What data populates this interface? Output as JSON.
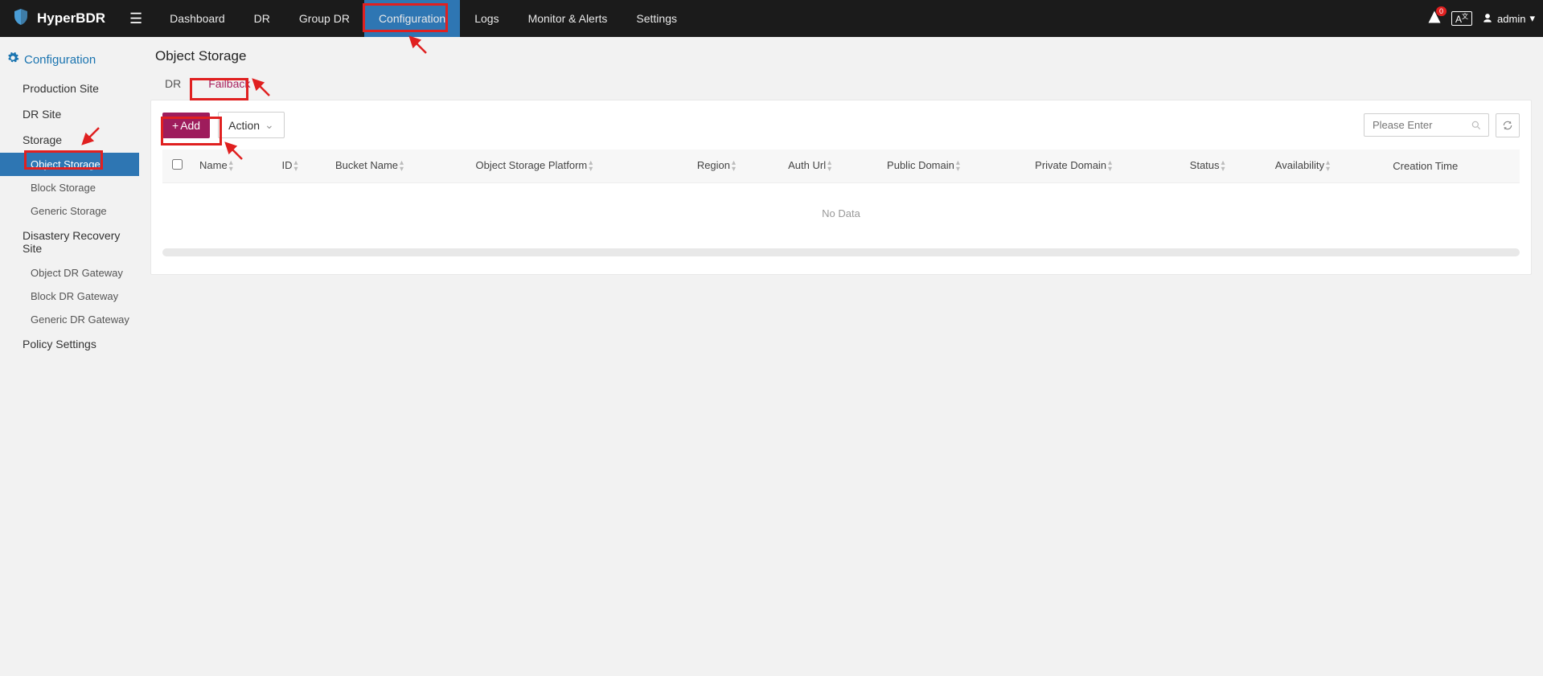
{
  "brand": {
    "name": "HyperBDR"
  },
  "nav": {
    "items": [
      {
        "label": "Dashboard",
        "active": false
      },
      {
        "label": "DR",
        "active": false
      },
      {
        "label": "Group DR",
        "active": false
      },
      {
        "label": "Configuration",
        "active": true
      },
      {
        "label": "Logs",
        "active": false
      },
      {
        "label": "Monitor & Alerts",
        "active": false
      },
      {
        "label": "Settings",
        "active": false
      }
    ]
  },
  "header_right": {
    "notification_count": "0",
    "lang_label": "A",
    "user_name": "admin"
  },
  "sidebar": {
    "title": "Configuration",
    "items": [
      {
        "label": "Production Site",
        "type": "item"
      },
      {
        "label": "DR Site",
        "type": "item"
      },
      {
        "label": "Storage",
        "type": "item"
      },
      {
        "label": "Object Storage",
        "type": "sub",
        "active": true
      },
      {
        "label": "Block Storage",
        "type": "sub"
      },
      {
        "label": "Generic Storage",
        "type": "sub"
      },
      {
        "label": "Disastery Recovery Site",
        "type": "item"
      },
      {
        "label": "Object DR Gateway",
        "type": "sub"
      },
      {
        "label": "Block DR Gateway",
        "type": "sub"
      },
      {
        "label": "Generic DR Gateway",
        "type": "sub"
      },
      {
        "label": "Policy Settings",
        "type": "item"
      }
    ]
  },
  "page": {
    "title": "Object Storage",
    "tabs": [
      {
        "label": "DR",
        "active": false
      },
      {
        "label": "Failback",
        "active": true
      }
    ],
    "toolbar": {
      "add_label": "Add",
      "action_label": "Action",
      "search_placeholder": "Please Enter"
    },
    "table": {
      "columns": [
        "Name",
        "ID",
        "Bucket Name",
        "Object Storage Platform",
        "Region",
        "Auth Url",
        "Public Domain",
        "Private Domain",
        "Status",
        "Availability",
        "Creation Time"
      ],
      "no_data_label": "No Data"
    }
  },
  "colors": {
    "nav_active": "#2e76b3",
    "primary_magenta": "#9e1c5c",
    "highlight_red": "#e02020"
  }
}
